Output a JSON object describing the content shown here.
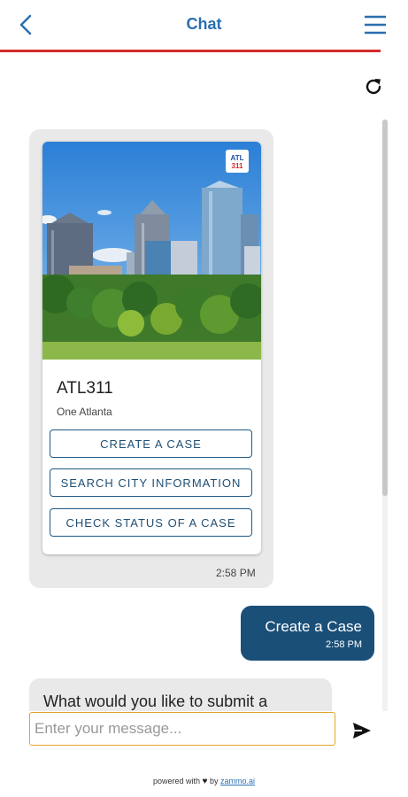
{
  "header": {
    "title": "Chat"
  },
  "card": {
    "title": "ATL311",
    "subtitle": "One Atlanta",
    "logo_text_top": "ATL",
    "logo_text_bottom": "311",
    "buttons": [
      "CREATE A CASE",
      "SEARCH CITY INFORMATION",
      "CHECK STATUS OF A CASE"
    ]
  },
  "messages": [
    {
      "sender": "bot",
      "time": "2:58 PM"
    },
    {
      "sender": "user",
      "text": "Create a Case",
      "time": "2:58 PM"
    },
    {
      "sender": "bot",
      "text": "What would you like to submit a"
    }
  ],
  "input": {
    "placeholder": "Enter your message..."
  },
  "footer": {
    "prefix": "powered with",
    "by": "by",
    "link": "zammo.ai"
  },
  "colors": {
    "accent": "#2a6fb0",
    "header_line": "#d32a2a",
    "user_bubble": "#1a4f78",
    "input_border": "#e0a526"
  }
}
